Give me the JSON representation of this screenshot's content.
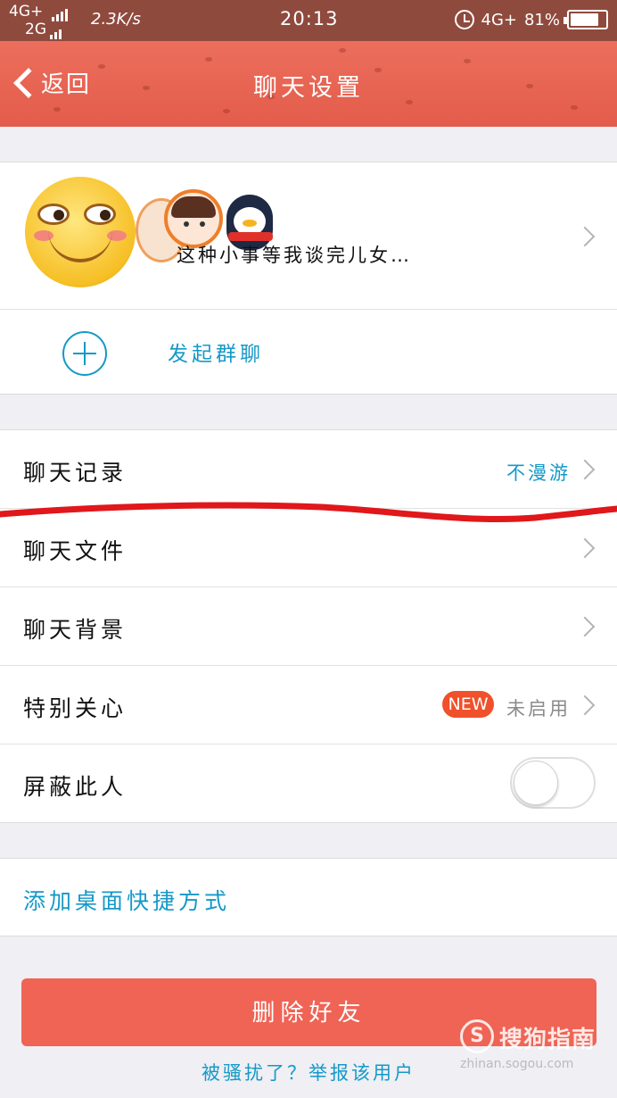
{
  "status_bar": {
    "network1": "4G+",
    "network2": "2G",
    "speed": "2.3K/s",
    "time": "20:13",
    "network3": "4G+",
    "battery_pct": "81%",
    "battery_level": 0.81
  },
  "header": {
    "back_label": "返回",
    "title": "聊天设置",
    "color": "#e8624f"
  },
  "friend": {
    "signature": "这种小事等我谈完儿女…"
  },
  "group_chat": {
    "label": "发起群聊"
  },
  "settings": {
    "chat_history": {
      "label": "聊天记录",
      "value": "不漫游"
    },
    "chat_files": {
      "label": "聊天文件"
    },
    "chat_background": {
      "label": "聊天背景"
    },
    "special_care": {
      "label": "特别关心",
      "badge": "NEW",
      "value": "未启用"
    },
    "block": {
      "label": "屏蔽此人",
      "enabled": false
    }
  },
  "shortcut": {
    "label": "添加桌面快捷方式"
  },
  "actions": {
    "delete_label": "删除好友",
    "report_label": "被骚扰了？举报该用户"
  },
  "watermark": {
    "logo": "S",
    "name": "搜狗指南",
    "url": "zhinan.sogou.com"
  },
  "colors": {
    "accent_blue": "#1599c8",
    "delete_red": "#ef6455",
    "badge_red": "#f0502a",
    "annotation_red": "#e0171b"
  }
}
